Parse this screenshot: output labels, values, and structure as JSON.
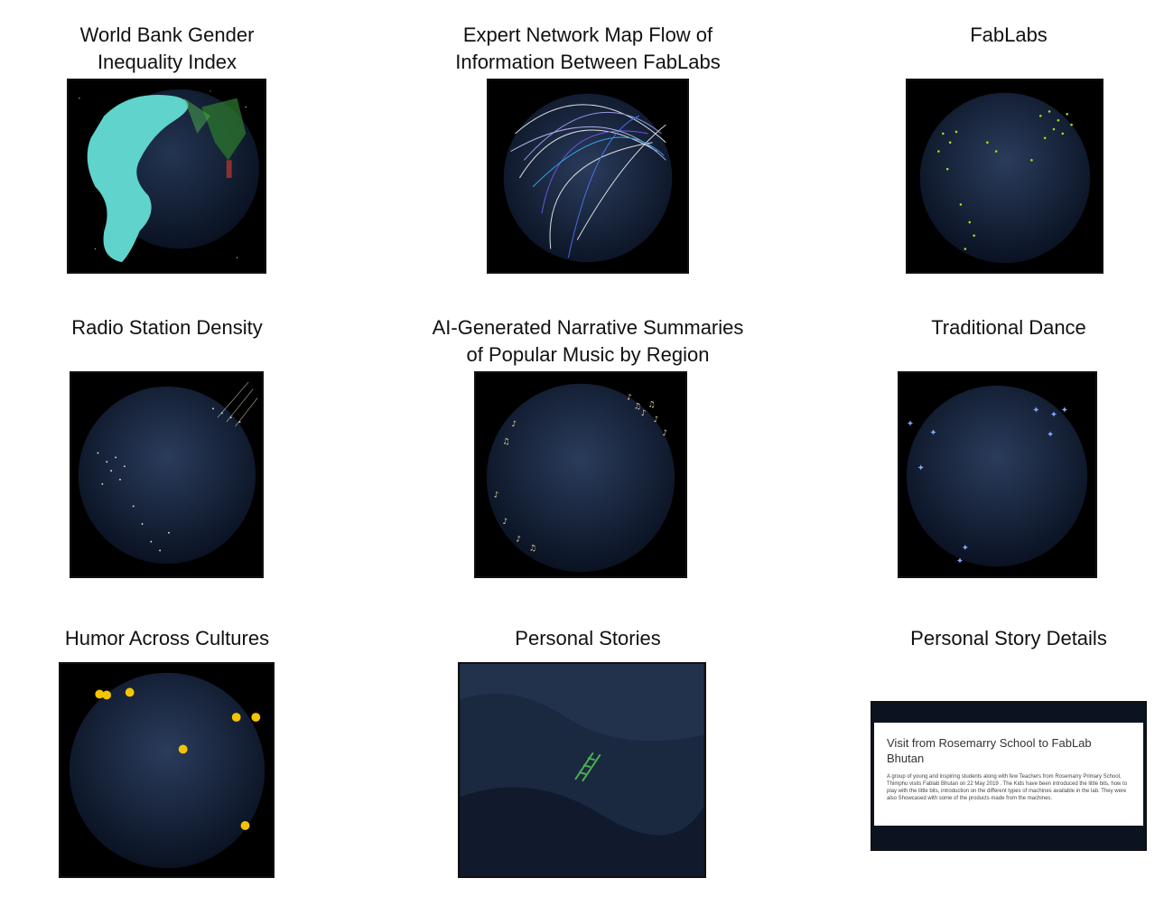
{
  "panels": [
    {
      "title_lines": [
        "World Bank Gender",
        "Inequality Index"
      ],
      "icon": "globe-gender-index-icon"
    },
    {
      "title_lines": [
        "Expert Network Map Flow of",
        "Information Between FabLabs"
      ],
      "icon": "globe-network-flow-icon"
    },
    {
      "title_lines": [
        "FabLabs"
      ],
      "icon": "globe-fablabs-icon"
    },
    {
      "title_lines": [
        "Radio Station Density"
      ],
      "icon": "globe-radio-density-icon"
    },
    {
      "title_lines": [
        "AI-Generated Narrative Summaries",
        "of Popular Music by Region"
      ],
      "icon": "globe-music-notes-icon"
    },
    {
      "title_lines": [
        "Traditional Dance"
      ],
      "icon": "globe-dancer-icon"
    },
    {
      "title_lines": [
        "Humor Across Cultures"
      ],
      "icon": "globe-laughing-face-icon"
    },
    {
      "title_lines": [
        "Personal Stories"
      ],
      "icon": "dna-icon"
    },
    {
      "title_lines": [
        "Personal Story Details"
      ],
      "icon": "story-card-icon"
    }
  ],
  "story": {
    "title": "Visit from Rosemarry School to FabLab Bhutan",
    "body": "A group of young and inspiring students along with few Teachers from Rosemarry Primary School, Thimphu visits Fablab Bhutan on 22 May 2019 . The Kids have been introduced the little bits, how to play with the little bits, introduction on the different types of machines available in the lab. They were also Showcased with some of the products made from the machines."
  },
  "colors": {
    "space": "#000000",
    "ocean": "#16243d",
    "land_dark": "#2a3a55",
    "gender_land": "#5fd3cc",
    "fablab_dots": "#9be81a",
    "city_lights": "#e9e4d0"
  }
}
